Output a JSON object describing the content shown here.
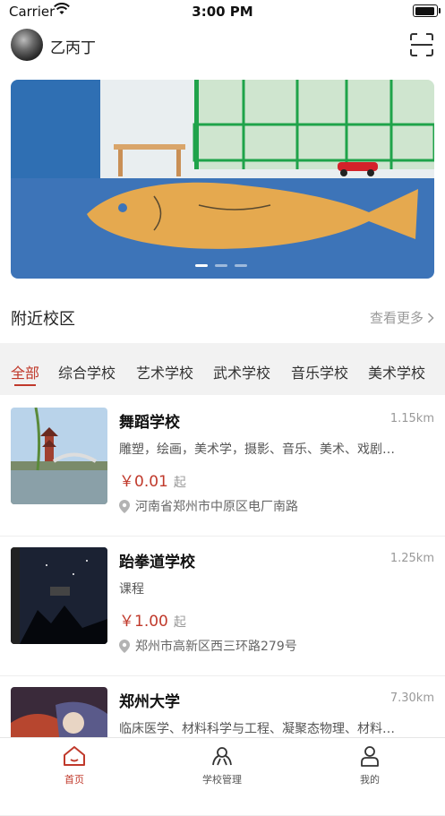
{
  "status_bar": {
    "carrier": "Carrier",
    "time": "3:00 PM"
  },
  "header": {
    "username": "乙丙丁"
  },
  "banner": {
    "page_count": 3,
    "active_index": 0
  },
  "nearby": {
    "title": "附近校区",
    "see_more": "查看更多"
  },
  "tabs": [
    "全部",
    "综合学校",
    "艺术学校",
    "武术学校",
    "音乐学校",
    "美术学校"
  ],
  "schools": [
    {
      "name": "舞蹈学校",
      "distance": "1.15km",
      "desc": "雕塑，绘画，美术学，摄影、音乐、美术、戏剧…",
      "price": "￥0.01",
      "price_suffix": "起",
      "address": "河南省郑州市中原区电厂南路"
    },
    {
      "name": "跆拳道学校",
      "distance": "1.25km",
      "desc": "课程",
      "price": "￥1.00",
      "price_suffix": "起",
      "address": "郑州市高新区西三环路279号"
    },
    {
      "name": "郑州大学",
      "distance": "7.30km",
      "desc": "临床医学、材料科学与工程、凝聚态物理、材料…",
      "price": "",
      "price_suffix": "",
      "address": ""
    }
  ],
  "bottom_nav": [
    {
      "label": "首页",
      "icon": "home-icon",
      "active": true
    },
    {
      "label": "学校管理",
      "icon": "school-manage-icon",
      "active": false
    },
    {
      "label": "我的",
      "icon": "profile-icon",
      "active": false
    }
  ],
  "colors": {
    "accent": "#c0392b",
    "tab_bg": "#f2f2f2"
  }
}
